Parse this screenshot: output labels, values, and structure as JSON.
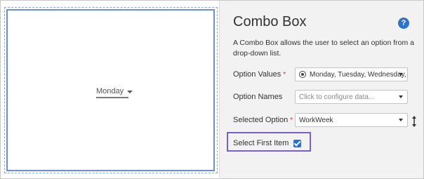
{
  "preview": {
    "dropdown_value": "Monday"
  },
  "panel": {
    "title": "Combo Box",
    "help_label": "?",
    "description": "A Combo Box allows the user to select an option from a drop-down list."
  },
  "fields": {
    "option_values": {
      "label": "Option Values",
      "required_mark": "*",
      "value": "Monday, Tuesday, Wednesday,"
    },
    "option_names": {
      "label": "Option Names",
      "placeholder": "Click to configure data..."
    },
    "selected_option": {
      "label": "Selected Option",
      "required_mark": "*",
      "value": "WorkWeek"
    },
    "select_first_item": {
      "label": "Select First Item",
      "checked": true
    }
  },
  "colors": {
    "accent": "#2d6cd0",
    "highlight": "#7a5ec9",
    "required": "#d32f2f"
  }
}
